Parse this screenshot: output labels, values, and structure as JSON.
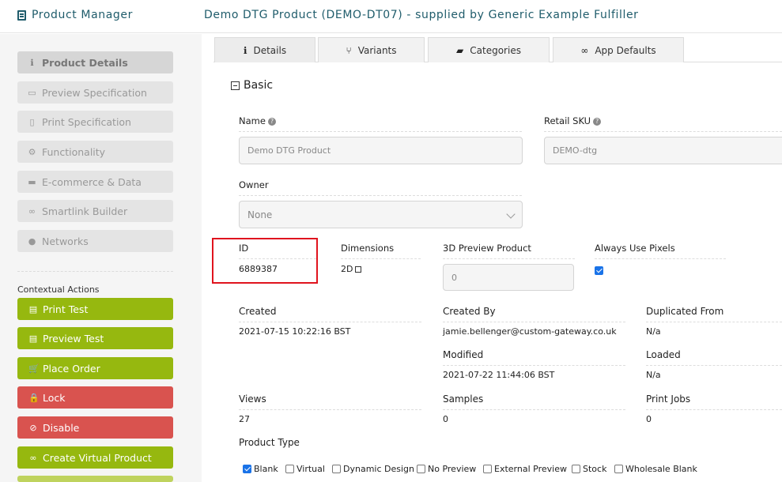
{
  "header": {
    "app_title": "Product Manager",
    "product_title": "Demo DTG Product (DEMO-DT07) - supplied by Generic Example Fulfiller"
  },
  "sidebar": {
    "nav": [
      {
        "label": "Product Details",
        "icon": "info-icon",
        "active": true
      },
      {
        "label": "Preview Specification",
        "icon": "monitor-icon"
      },
      {
        "label": "Print Specification",
        "icon": "pdf-file-icon"
      },
      {
        "label": "Functionality",
        "icon": "cogs-icon"
      },
      {
        "label": "E-commerce & Data",
        "icon": "credit-card-icon"
      },
      {
        "label": "Smartlink Builder",
        "icon": "link-icon"
      },
      {
        "label": "Networks",
        "icon": "globe-icon"
      }
    ],
    "contextual_label": "Contextual Actions",
    "actions": [
      {
        "label": "Print Test",
        "icon": "print-icon",
        "color": "#96b80f"
      },
      {
        "label": "Preview Test",
        "icon": "print-icon",
        "color": "#96b80f"
      },
      {
        "label": "Place Order",
        "icon": "cart-icon",
        "color": "#96b80f"
      },
      {
        "label": "Lock",
        "icon": "lock-icon",
        "color": "#d9534f"
      },
      {
        "label": "Disable",
        "icon": "ban-icon",
        "color": "#d9534f"
      },
      {
        "label": "Create Virtual Product",
        "icon": "link-icon",
        "color": "#96b80f"
      }
    ]
  },
  "tabs": [
    {
      "label": "Details",
      "icon": "info-icon",
      "active": true
    },
    {
      "label": "Variants",
      "icon": "branch-icon"
    },
    {
      "label": "Categories",
      "icon": "folder-icon"
    },
    {
      "label": "App Defaults",
      "icon": "link-icon"
    }
  ],
  "section": {
    "title": "Basic"
  },
  "fields": {
    "name": {
      "label": "Name",
      "value": "Demo DTG Product"
    },
    "retail_sku": {
      "label": "Retail SKU",
      "value": "DEMO-dtg"
    },
    "owner": {
      "label": "Owner",
      "value": "None"
    },
    "id": {
      "label": "ID",
      "value": "6889387"
    },
    "dimensions": {
      "label": "Dimensions",
      "value": "2D"
    },
    "preview_3d": {
      "label": "3D Preview Product",
      "value": "0"
    },
    "always_pixels": {
      "label": "Always Use Pixels",
      "checked": true
    },
    "created": {
      "label": "Created",
      "value": "2021-07-15 10:22:16 BST"
    },
    "created_by": {
      "label": "Created By",
      "value": "jamie.bellenger@custom-gateway.co.uk"
    },
    "duplicated_from": {
      "label": "Duplicated From",
      "value": "N/a"
    },
    "modified": {
      "label": "Modified",
      "value": "2021-07-22 11:44:06 BST"
    },
    "loaded": {
      "label": "Loaded",
      "value": "N/a"
    },
    "views": {
      "label": "Views",
      "value": "27"
    },
    "samples": {
      "label": "Samples",
      "value": "0"
    },
    "print_jobs": {
      "label": "Print Jobs",
      "value": "0"
    },
    "product_type": {
      "label": "Product Type",
      "options": [
        {
          "label": "Blank",
          "checked": true
        },
        {
          "label": "Virtual",
          "checked": false
        },
        {
          "label": "Dynamic Design",
          "checked": false
        },
        {
          "label": "No Preview",
          "checked": false
        },
        {
          "label": "External Preview",
          "checked": false
        },
        {
          "label": "Stock",
          "checked": false
        },
        {
          "label": "Wholesale Blank",
          "checked": false
        }
      ]
    }
  }
}
